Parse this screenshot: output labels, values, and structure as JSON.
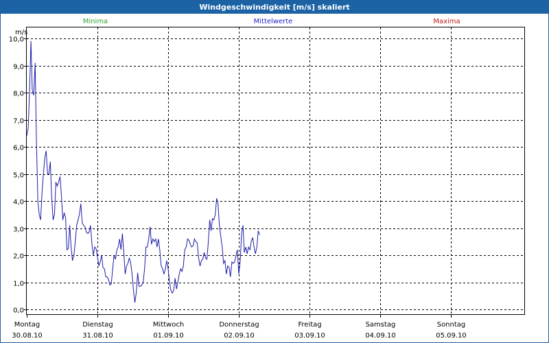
{
  "window": {
    "title": "Windgeschwindigkeit [m/s] skaliert"
  },
  "legend": [
    {
      "label": "Minima",
      "color": "#2ca02c"
    },
    {
      "label": "Mittelwerte",
      "color": "#2323c8"
    },
    {
      "label": "Maxima",
      "color": "#c01818"
    }
  ],
  "chart_data": {
    "type": "line",
    "title": "Windgeschwindigkeit [m/s] skaliert",
    "ylabel": "m/s",
    "xlabel": "",
    "ylim": [
      0,
      10
    ],
    "yticks": [
      "0,0",
      "1,0",
      "2,0",
      "3,0",
      "4,0",
      "5,0",
      "6,0",
      "7,0",
      "8,0",
      "9,0",
      "10,0"
    ],
    "xlim": [
      0,
      7
    ],
    "x_ticks": [
      {
        "weekday": "Montag",
        "date": "30.08.10"
      },
      {
        "weekday": "Dienstag",
        "date": "31.08.10"
      },
      {
        "weekday": "Mittwoch",
        "date": "01.09.10"
      },
      {
        "weekday": "Donnerstag",
        "date": "02.09.10"
      },
      {
        "weekday": "Freitag",
        "date": "03.09.10"
      },
      {
        "weekday": "Samstag",
        "date": "04.09.10"
      },
      {
        "weekday": "Sonntag",
        "date": "05.09.10"
      }
    ],
    "grid": true,
    "legend_position": "top",
    "series": [
      {
        "name": "Mittelwerte",
        "color": "#1a1aa8",
        "points": [
          [
            0.0,
            6.4
          ],
          [
            0.02,
            6.7
          ],
          [
            0.039,
            8.0
          ],
          [
            0.059,
            9.9
          ],
          [
            0.078,
            8.1
          ],
          [
            0.098,
            7.9
          ],
          [
            0.118,
            9.1
          ],
          [
            0.137,
            6.2
          ],
          [
            0.157,
            4.0
          ],
          [
            0.176,
            3.5
          ],
          [
            0.196,
            3.3
          ],
          [
            0.216,
            4.3
          ],
          [
            0.235,
            5.0
          ],
          [
            0.255,
            5.6
          ],
          [
            0.275,
            5.85
          ],
          [
            0.294,
            5.0
          ],
          [
            0.314,
            5.0
          ],
          [
            0.333,
            5.45
          ],
          [
            0.353,
            4.1
          ],
          [
            0.373,
            3.3
          ],
          [
            0.392,
            3.5
          ],
          [
            0.412,
            4.7
          ],
          [
            0.431,
            4.55
          ],
          [
            0.451,
            4.7
          ],
          [
            0.471,
            4.9
          ],
          [
            0.49,
            4.2
          ],
          [
            0.51,
            3.3
          ],
          [
            0.529,
            3.55
          ],
          [
            0.549,
            3.4
          ],
          [
            0.569,
            2.2
          ],
          [
            0.588,
            2.25
          ],
          [
            0.608,
            3.1
          ],
          [
            0.627,
            2.3
          ],
          [
            0.647,
            1.8
          ],
          [
            0.667,
            2.0
          ],
          [
            0.686,
            2.5
          ],
          [
            0.706,
            3.1
          ],
          [
            0.725,
            3.3
          ],
          [
            0.745,
            3.5
          ],
          [
            0.765,
            3.9
          ],
          [
            0.784,
            3.2
          ],
          [
            0.804,
            3.1
          ],
          [
            0.824,
            3.05
          ],
          [
            0.843,
            2.85
          ],
          [
            0.863,
            2.8
          ],
          [
            0.882,
            2.85
          ],
          [
            0.902,
            3.1
          ],
          [
            0.922,
            2.4
          ],
          [
            0.941,
            2.0
          ],
          [
            0.961,
            2.3
          ],
          [
            0.98,
            2.25
          ],
          [
            1.0,
            1.95
          ],
          [
            1.02,
            1.6
          ],
          [
            1.039,
            1.75
          ],
          [
            1.059,
            2.0
          ],
          [
            1.078,
            1.55
          ],
          [
            1.098,
            1.5
          ],
          [
            1.118,
            1.2
          ],
          [
            1.137,
            1.2
          ],
          [
            1.157,
            1.1
          ],
          [
            1.176,
            0.9
          ],
          [
            1.196,
            0.95
          ],
          [
            1.216,
            1.5
          ],
          [
            1.235,
            2.0
          ],
          [
            1.255,
            1.85
          ],
          [
            1.275,
            2.2
          ],
          [
            1.294,
            2.3
          ],
          [
            1.314,
            2.6
          ],
          [
            1.333,
            2.2
          ],
          [
            1.353,
            2.8
          ],
          [
            1.373,
            2.1
          ],
          [
            1.392,
            1.3
          ],
          [
            1.412,
            1.6
          ],
          [
            1.431,
            1.7
          ],
          [
            1.451,
            1.9
          ],
          [
            1.471,
            1.7
          ],
          [
            1.49,
            1.3
          ],
          [
            1.51,
            0.7
          ],
          [
            1.529,
            0.25
          ],
          [
            1.549,
            0.6
          ],
          [
            1.569,
            1.35
          ],
          [
            1.588,
            0.85
          ],
          [
            1.608,
            0.85
          ],
          [
            1.627,
            0.9
          ],
          [
            1.647,
            1.0
          ],
          [
            1.667,
            1.5
          ],
          [
            1.686,
            2.3
          ],
          [
            1.706,
            2.3
          ],
          [
            1.725,
            2.6
          ],
          [
            1.745,
            3.05
          ],
          [
            1.765,
            2.4
          ],
          [
            1.784,
            2.6
          ],
          [
            1.804,
            2.5
          ],
          [
            1.824,
            2.6
          ],
          [
            1.843,
            2.3
          ],
          [
            1.863,
            2.6
          ],
          [
            1.882,
            2.2
          ],
          [
            1.902,
            1.6
          ],
          [
            1.922,
            1.5
          ],
          [
            1.941,
            1.3
          ],
          [
            1.961,
            1.5
          ],
          [
            1.98,
            1.8
          ],
          [
            2.0,
            1.5
          ],
          [
            2.02,
            1.0
          ],
          [
            2.039,
            0.7
          ],
          [
            2.059,
            0.6
          ],
          [
            2.078,
            0.7
          ],
          [
            2.098,
            1.15
          ],
          [
            2.118,
            0.75
          ],
          [
            2.137,
            1.0
          ],
          [
            2.157,
            1.3
          ],
          [
            2.176,
            1.5
          ],
          [
            2.196,
            1.4
          ],
          [
            2.216,
            1.6
          ],
          [
            2.235,
            2.2
          ],
          [
            2.255,
            2.3
          ],
          [
            2.275,
            2.6
          ],
          [
            2.294,
            2.55
          ],
          [
            2.314,
            2.4
          ],
          [
            2.333,
            2.3
          ],
          [
            2.353,
            2.35
          ],
          [
            2.373,
            2.6
          ],
          [
            2.392,
            2.5
          ],
          [
            2.412,
            2.45
          ],
          [
            2.431,
            1.9
          ],
          [
            2.451,
            1.6
          ],
          [
            2.471,
            1.8
          ],
          [
            2.49,
            1.85
          ],
          [
            2.51,
            2.1
          ],
          [
            2.529,
            1.9
          ],
          [
            2.549,
            1.85
          ],
          [
            2.569,
            2.5
          ],
          [
            2.588,
            3.3
          ],
          [
            2.608,
            2.9
          ],
          [
            2.627,
            3.35
          ],
          [
            2.647,
            3.3
          ],
          [
            2.667,
            3.5
          ],
          [
            2.686,
            4.1
          ],
          [
            2.706,
            3.9
          ],
          [
            2.725,
            3.1
          ],
          [
            2.745,
            2.7
          ],
          [
            2.765,
            2.3
          ],
          [
            2.784,
            1.7
          ],
          [
            2.804,
            1.8
          ],
          [
            2.824,
            1.3
          ],
          [
            2.843,
            1.6
          ],
          [
            2.863,
            1.55
          ],
          [
            2.882,
            1.2
          ],
          [
            2.902,
            1.75
          ],
          [
            2.922,
            1.7
          ],
          [
            2.941,
            1.75
          ],
          [
            2.961,
            2.0
          ],
          [
            2.98,
            2.2
          ],
          [
            3.0,
            1.3
          ],
          [
            3.02,
            1.8
          ],
          [
            3.039,
            2.8
          ],
          [
            3.059,
            3.1
          ],
          [
            3.078,
            2.1
          ],
          [
            3.098,
            2.3
          ],
          [
            3.118,
            2.05
          ],
          [
            3.137,
            2.3
          ],
          [
            3.157,
            2.2
          ],
          [
            3.176,
            2.5
          ],
          [
            3.196,
            2.65
          ],
          [
            3.216,
            2.3
          ],
          [
            3.235,
            2.05
          ],
          [
            3.255,
            2.3
          ],
          [
            3.275,
            2.9
          ],
          [
            3.294,
            2.75
          ]
        ]
      }
    ]
  }
}
